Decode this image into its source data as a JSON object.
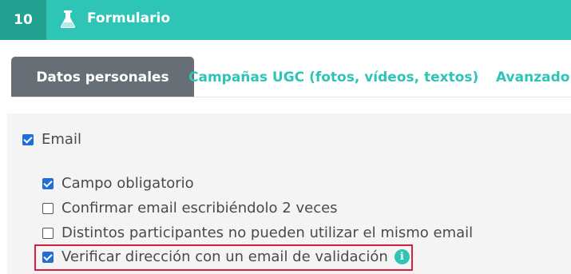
{
  "header": {
    "step_number": "10",
    "title": "Formulario",
    "icon": "flask-icon"
  },
  "tabs": [
    {
      "label": "Datos personales",
      "active": true
    },
    {
      "label": "Campañas UGC (fotos, vídeos, textos)",
      "active": false
    },
    {
      "label": "Avanzado",
      "active": false
    }
  ],
  "fields": {
    "email": {
      "label": "Email",
      "checked": true
    },
    "options": [
      {
        "label": "Campo obligatorio",
        "checked": true
      },
      {
        "label": "Confirmar email escribiéndolo 2 veces",
        "checked": false
      },
      {
        "label": "Distintos participantes no pueden utilizar el mismo email",
        "checked": false
      },
      {
        "label": "Verificar dirección con un email de validación",
        "checked": true,
        "highlighted": true,
        "info_icon": "info-icon"
      }
    ]
  },
  "colors": {
    "accent": "#2ec4b6",
    "accent_dark": "#22a191",
    "active_tab": "#686e75",
    "checkbox": "#1f6fd6",
    "highlight_border": "#d6203c"
  }
}
